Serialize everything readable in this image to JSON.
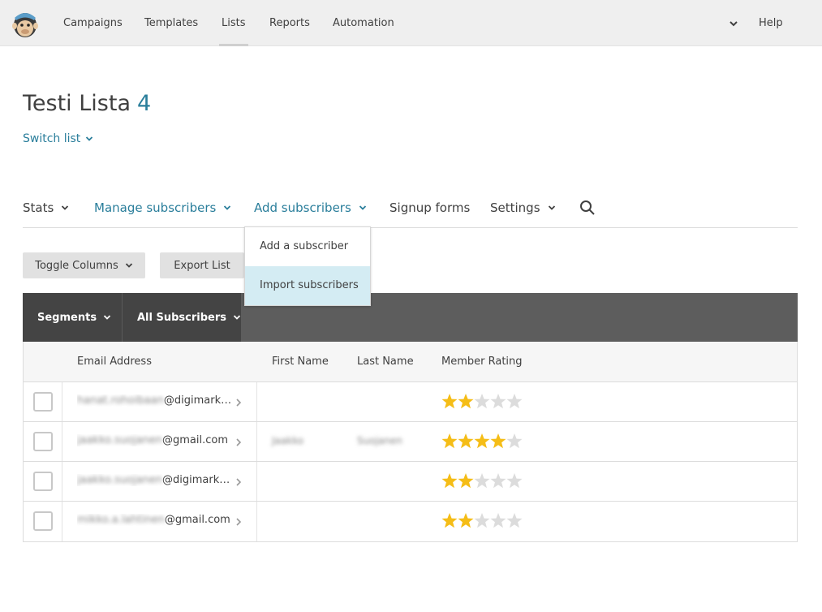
{
  "nav": {
    "items": [
      "Campaigns",
      "Templates",
      "Lists",
      "Reports",
      "Automation"
    ],
    "help": "Help"
  },
  "list": {
    "title": "Testi Lista",
    "count": "4",
    "switch_label": "Switch list"
  },
  "subnav": {
    "stats": "Stats",
    "manage": "Manage subscribers",
    "add": "Add subscribers",
    "signup": "Signup forms",
    "settings": "Settings"
  },
  "dropdown": {
    "items": [
      "Add a subscriber",
      "Import subscribers"
    ]
  },
  "buttons": {
    "toggle_columns": "Toggle Columns",
    "export_list": "Export List"
  },
  "segments": {
    "segments_label": "Segments",
    "all_label": "All Subscribers"
  },
  "table": {
    "columns": [
      "Email Address",
      "First Name",
      "Last Name",
      "Member Rating"
    ],
    "rows": [
      {
        "email_hidden": "hanat.rohoibaan",
        "email_domain": "@digimarkkinointi.fi",
        "first": "",
        "last": "",
        "rating": 2
      },
      {
        "email_hidden": "jaakko.suojanen",
        "email_domain": "@gmail.com",
        "first": "Jaakko",
        "last": "Suojanen",
        "rating": 4
      },
      {
        "email_hidden": "jaakko.suojanen",
        "email_domain": "@digimarkkinointi.fi",
        "first": "",
        "last": "",
        "rating": 2
      },
      {
        "email_hidden": "mikko.a.lahtinen",
        "email_domain": "@gmail.com",
        "first": "",
        "last": "",
        "rating": 2
      }
    ]
  },
  "colors": {
    "accent": "#2a7e9b",
    "star_on": "#f5bd17",
    "star_off": "#dcdcdc",
    "segbar": "#5d5d5d"
  }
}
